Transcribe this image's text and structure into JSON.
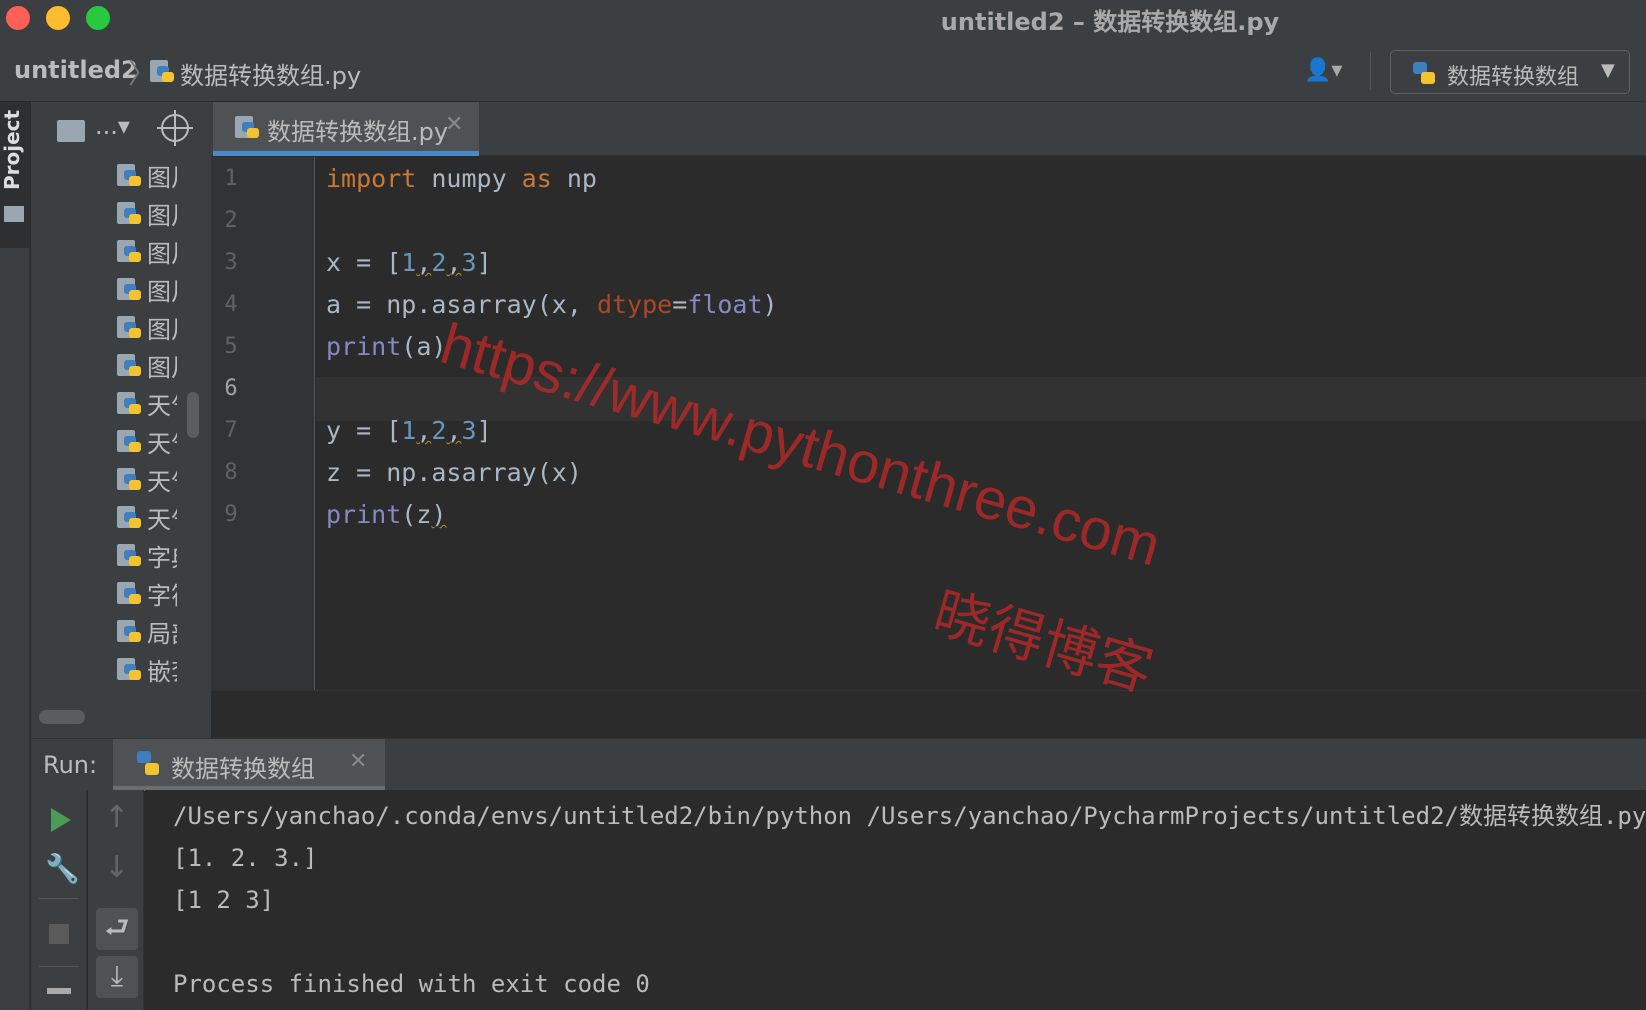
{
  "window": {
    "title": "untitled2 – 数据转换数组.py"
  },
  "navbar": {
    "project": "untitled2",
    "file": "数据转换数组.py",
    "run_config": "数据转换数组"
  },
  "sidebar": {
    "tool_window_label": "Project"
  },
  "project_panel": {
    "dots_label": "...",
    "files": [
      "图片",
      "图片",
      "图片",
      "图片",
      "图片",
      "图片",
      "天气",
      "天气",
      "天气",
      "天气",
      "字典",
      "字符",
      "局部",
      "嵌套"
    ]
  },
  "editor": {
    "tab_label": "数据转换数组.py",
    "current_line": 6,
    "line_numbers": [
      "1",
      "2",
      "3",
      "4",
      "5",
      "6",
      "7",
      "8",
      "9"
    ]
  },
  "watermark": {
    "url": "https://www.pythonthree.com",
    "name": "晓得博客"
  },
  "run": {
    "label": "Run:",
    "tab_label": "数据转换数组",
    "output": [
      "/Users/yanchao/.conda/envs/untitled2/bin/python /Users/yanchao/PycharmProjects/untitled2/数据转换数组.py",
      "[1. 2. 3.]",
      "[1 2 3]",
      "",
      "Process finished with exit code 0"
    ]
  },
  "icons": [
    "python-file-icon",
    "user-icon",
    "folder-icon",
    "locate-icon",
    "close-icon",
    "run-icon",
    "wrench-icon",
    "stop-icon",
    "up-arrow-icon",
    "down-arrow-icon",
    "soft-wrap-icon",
    "scroll-to-end-icon"
  ],
  "colors": {
    "accent": "#4a88c7",
    "keyword": "#cc7832",
    "number": "#6897bb",
    "builtin": "#8888c6",
    "watermark": "#be2828"
  }
}
